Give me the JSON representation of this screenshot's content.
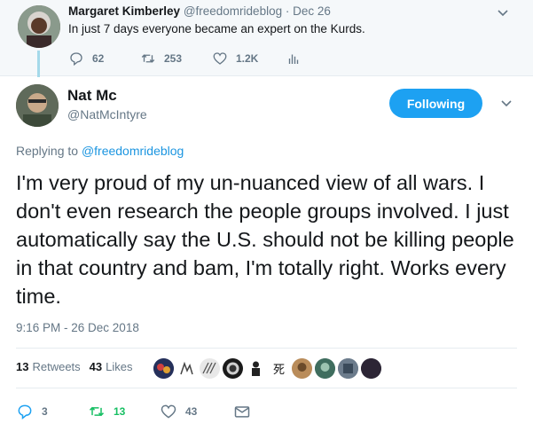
{
  "parent_tweet": {
    "name": "Margaret Kimberley",
    "handle": "@freedomrideblog",
    "separator": "·",
    "date": "Dec 26",
    "text": "In just 7 days everyone became an expert on the Kurds.",
    "replies": "62",
    "retweets": "253",
    "likes": "1.2K"
  },
  "main_tweet": {
    "name": "Nat Mc",
    "handle": "@NatMcIntyre",
    "follow_label": "Following",
    "replying_prefix": "Replying to",
    "replying_handle": "@freedomrideblog",
    "text": "I'm very proud of my un-nuanced view of all wars. I don't even research the people groups involved. I just automatically say the U.S. should not be killing people in that country and bam, I'm totally right. Works every time.",
    "timestamp": "9:16 PM - 26 Dec 2018",
    "retweets_count": "13",
    "retweets_label": "Retweets",
    "likes_count": "43",
    "likes_label": "Likes",
    "avatar_glyph_kanji": "死",
    "reply_count": "3",
    "retweet_count": "13",
    "like_count": "43"
  },
  "colors": {
    "accent": "#1da1f2",
    "link": "#1b95e0",
    "muted": "#657786",
    "retweet_green": "#17bf63",
    "parent_bg": "#f5f8fa",
    "thread_line": "#a4d9ea"
  },
  "icons": [
    "reply-icon",
    "retweet-icon",
    "like-icon",
    "analytics-icon",
    "chevron-down-icon",
    "message-icon"
  ]
}
